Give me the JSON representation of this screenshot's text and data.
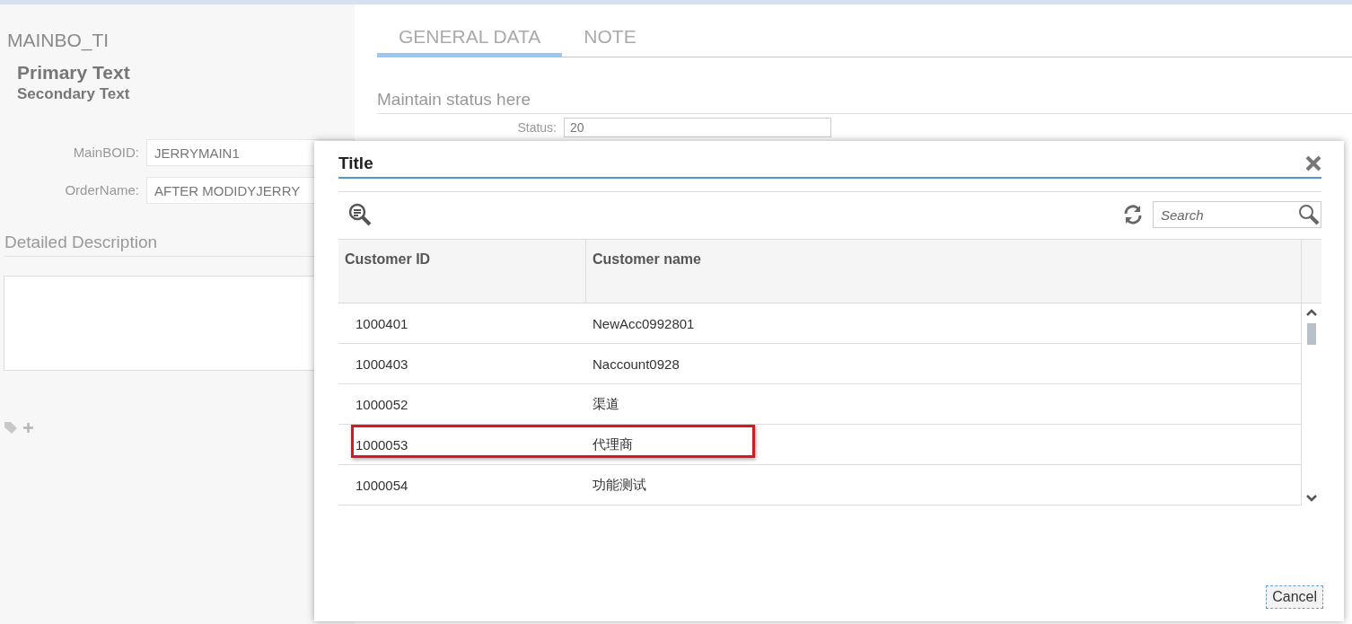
{
  "header": {
    "title": "MAINBO_TI",
    "primary_text": "Primary Text",
    "secondary_text": "Secondary Text"
  },
  "fields": [
    {
      "label": "MainBOID:",
      "value": "JERRYMAIN1"
    },
    {
      "label": "OrderName:",
      "value": "AFTER MODIDYJERRY"
    }
  ],
  "description": {
    "title": "Detailed Description"
  },
  "tabs": [
    {
      "label": "GENERAL DATA",
      "selected": true
    },
    {
      "label": "NOTE",
      "selected": false
    }
  ],
  "status_section": {
    "title": "Maintain status here",
    "status_label": "Status:",
    "status_value": "20"
  },
  "dialog": {
    "title": "Title",
    "search": {
      "placeholder": "Search"
    },
    "table": {
      "columns": [
        "Customer ID",
        "Customer name"
      ],
      "rows": [
        {
          "cells": [
            "1000401",
            "NewAcc0992801"
          ],
          "highlighted": false
        },
        {
          "cells": [
            "1000403",
            "Naccount0928"
          ],
          "highlighted": false
        },
        {
          "cells": [
            "1000052",
            "渠道"
          ],
          "highlighted": false
        },
        {
          "cells": [
            "1000053",
            "代理商"
          ],
          "highlighted": true
        },
        {
          "cells": [
            "1000054",
            "功能测试"
          ],
          "highlighted": false
        }
      ]
    },
    "buttons": [
      "Cancel"
    ]
  }
}
